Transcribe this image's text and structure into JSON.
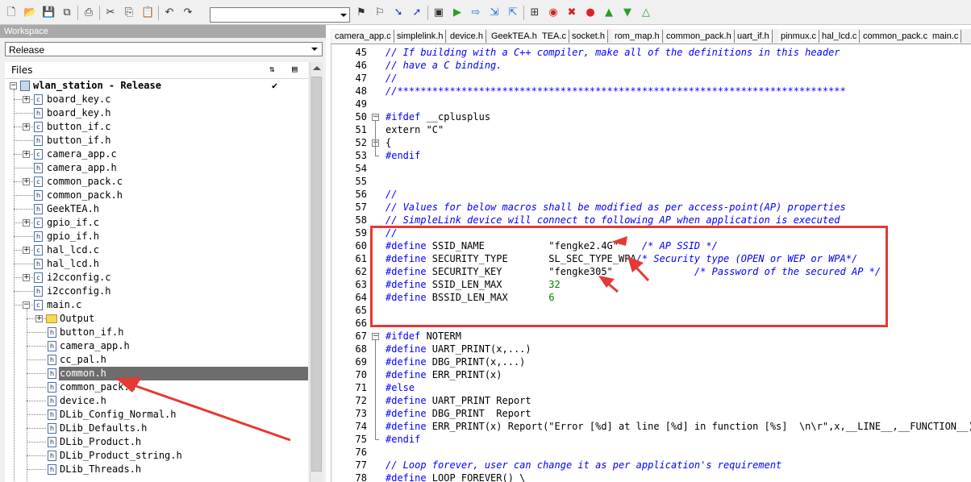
{
  "toolbar": {
    "icons": [
      "new-file-icon",
      "open-folder-icon",
      "save-icon",
      "save-all-icon",
      "print-icon",
      "cut-icon",
      "copy-icon",
      "paste-icon",
      "undo-icon",
      "redo-icon",
      "find-combo",
      "toggle-bookmark-icon",
      "clear-bookmarks-icon",
      "next-bookmark-icon",
      "prev-bookmark-icon",
      "compile-icon",
      "go-icon",
      "step-over-icon",
      "step-into-icon",
      "step-out-icon",
      "disassembly-icon",
      "breakpoint-icon",
      "clear-breakpoints-icon",
      "stop-icon",
      "debug-icon",
      "download-icon",
      "run-icon"
    ],
    "combo_value": ""
  },
  "workspace": {
    "title": "Workspace",
    "configuration": "Release",
    "files_header": "Files",
    "project": "wlan_station - Release",
    "project_check": "✔",
    "items": [
      {
        "name": "board_key.c",
        "type": "c",
        "expandable": true
      },
      {
        "name": "board_key.h",
        "type": "h",
        "expandable": false
      },
      {
        "name": "button_if.c",
        "type": "c",
        "expandable": true
      },
      {
        "name": "button_if.h",
        "type": "h",
        "expandable": false
      },
      {
        "name": "camera_app.c",
        "type": "c",
        "expandable": true
      },
      {
        "name": "camera_app.h",
        "type": "h",
        "expandable": false
      },
      {
        "name": "common_pack.c",
        "type": "c",
        "expandable": true
      },
      {
        "name": "common_pack.h",
        "type": "h",
        "expandable": false
      },
      {
        "name": "GeekTEA.h",
        "type": "h",
        "expandable": false
      },
      {
        "name": "gpio_if.c",
        "type": "c",
        "expandable": true
      },
      {
        "name": "gpio_if.h",
        "type": "h",
        "expandable": false
      },
      {
        "name": "hal_lcd.c",
        "type": "c",
        "expandable": true
      },
      {
        "name": "hal_lcd.h",
        "type": "h",
        "expandable": false
      },
      {
        "name": "i2cconfig.c",
        "type": "c",
        "expandable": true
      },
      {
        "name": "i2cconfig.h",
        "type": "h",
        "expandable": false
      },
      {
        "name": "main.c",
        "type": "c",
        "expandable": true,
        "expanded": true
      }
    ],
    "main_children": [
      {
        "name": "Output",
        "type": "folder"
      },
      {
        "name": "button_if.h",
        "type": "h"
      },
      {
        "name": "camera_app.h",
        "type": "h"
      },
      {
        "name": "cc_pal.h",
        "type": "h"
      },
      {
        "name": "common.h",
        "type": "h",
        "selected": true
      },
      {
        "name": "common_pack.h",
        "type": "h"
      },
      {
        "name": "device.h",
        "type": "h"
      },
      {
        "name": "DLib_Config_Normal.h",
        "type": "h"
      },
      {
        "name": "DLib_Defaults.h",
        "type": "h"
      },
      {
        "name": "DLib_Product.h",
        "type": "h"
      },
      {
        "name": "DLib_Product_string.h",
        "type": "h"
      },
      {
        "name": "DLib_Threads.h",
        "type": "h"
      }
    ]
  },
  "tabs": [
    "camera_app.c",
    "simplelink.h",
    "device.h",
    "GeekTEA.h",
    "TEA.c",
    "socket.h",
    "rom_map.h",
    "common_pack.h",
    "uart_if.h",
    "pinmux.c",
    "hal_lcd.c",
    "common_pack.c",
    "main.c"
  ],
  "editor": {
    "lines": [
      {
        "n": "45",
        "segs": [
          {
            "t": "// If building with a C++ compiler, make all of the definitions in this header",
            "c": "cm"
          }
        ]
      },
      {
        "n": "46",
        "segs": [
          {
            "t": "// have a C binding.",
            "c": "cm"
          }
        ]
      },
      {
        "n": "47",
        "segs": [
          {
            "t": "//",
            "c": "cm"
          }
        ]
      },
      {
        "n": "48",
        "segs": [
          {
            "t": "//*****************************************************************************",
            "c": "cm"
          }
        ]
      },
      {
        "n": "49",
        "segs": []
      },
      {
        "n": "50",
        "segs": [
          {
            "t": "#ifdef",
            "c": "pp"
          },
          {
            "t": " __cplusplus",
            "c": ""
          }
        ],
        "fold": "box"
      },
      {
        "n": "51",
        "segs": [
          {
            "t": "extern \"C\"",
            "c": ""
          }
        ]
      },
      {
        "n": "52",
        "segs": [
          {
            "t": "{",
            "c": ""
          }
        ],
        "fold": "box"
      },
      {
        "n": "53",
        "segs": [
          {
            "t": "#endif",
            "c": "pp"
          }
        ],
        "fold": "end"
      },
      {
        "n": "54",
        "segs": []
      },
      {
        "n": "55",
        "segs": []
      },
      {
        "n": "56",
        "segs": [
          {
            "t": "//",
            "c": "cm"
          }
        ]
      },
      {
        "n": "57",
        "segs": [
          {
            "t": "// Values for below macros shall be modified as per access-point(AP) properties",
            "c": "cm"
          }
        ]
      },
      {
        "n": "58",
        "segs": [
          {
            "t": "// SimpleLink device will connect to following AP when application is executed",
            "c": "cm"
          }
        ]
      },
      {
        "n": "59",
        "segs": [
          {
            "t": "//",
            "c": "cm"
          }
        ]
      },
      {
        "n": "60",
        "segs": [
          {
            "t": "#define",
            "c": "pp"
          },
          {
            "t": " SSID_NAME           \"fengke2.4G\"    ",
            "c": ""
          },
          {
            "t": "/* AP SSID */",
            "c": "cm"
          }
        ]
      },
      {
        "n": "61",
        "segs": [
          {
            "t": "#define",
            "c": "pp"
          },
          {
            "t": " SECURITY_TYPE       SL_SEC_TYPE_WPA",
            "c": ""
          },
          {
            "t": "/* Security type (OPEN or WEP or WPA*/",
            "c": "cm"
          }
        ]
      },
      {
        "n": "62",
        "segs": [
          {
            "t": "#define",
            "c": "pp"
          },
          {
            "t": " SECURITY_KEY        \"fengke305\"              ",
            "c": ""
          },
          {
            "t": "/* Password of the secured AP */",
            "c": "cm"
          }
        ]
      },
      {
        "n": "63",
        "segs": [
          {
            "t": "#define",
            "c": "pp"
          },
          {
            "t": " SSID_LEN_MAX        ",
            "c": ""
          },
          {
            "t": "32",
            "c": "nb"
          }
        ]
      },
      {
        "n": "64",
        "segs": [
          {
            "t": "#define",
            "c": "pp"
          },
          {
            "t": " BSSID_LEN_MAX       ",
            "c": ""
          },
          {
            "t": "6",
            "c": "nb"
          }
        ]
      },
      {
        "n": "65",
        "segs": []
      },
      {
        "n": "66",
        "segs": []
      },
      {
        "n": "67",
        "segs": [
          {
            "t": "#ifdef",
            "c": "pp"
          },
          {
            "t": " NOTERM",
            "c": ""
          }
        ],
        "fold": "box"
      },
      {
        "n": "68",
        "segs": [
          {
            "t": "#define",
            "c": "pp"
          },
          {
            "t": " UART_PRINT(x,...)",
            "c": ""
          }
        ]
      },
      {
        "n": "69",
        "segs": [
          {
            "t": "#define",
            "c": "pp"
          },
          {
            "t": " DBG_PRINT(x,...)",
            "c": ""
          }
        ]
      },
      {
        "n": "70",
        "segs": [
          {
            "t": "#define",
            "c": "pp"
          },
          {
            "t": " ERR_PRINT(x)",
            "c": ""
          }
        ]
      },
      {
        "n": "71",
        "segs": [
          {
            "t": "#else",
            "c": "pp"
          }
        ]
      },
      {
        "n": "72",
        "segs": [
          {
            "t": "#define",
            "c": "pp"
          },
          {
            "t": " UART_PRINT Report",
            "c": ""
          }
        ]
      },
      {
        "n": "73",
        "segs": [
          {
            "t": "#define",
            "c": "pp"
          },
          {
            "t": " DBG_PRINT  Report",
            "c": ""
          }
        ]
      },
      {
        "n": "74",
        "segs": [
          {
            "t": "#define",
            "c": "pp"
          },
          {
            "t": " ERR_PRINT(x) Report(\"Error [%d] at line [%d] in function [%s]  \\n\\r\",x,__LINE__,__FUNCTION__)",
            "c": ""
          }
        ]
      },
      {
        "n": "75",
        "segs": [
          {
            "t": "#endif",
            "c": "pp"
          }
        ],
        "fold": "end"
      },
      {
        "n": "76",
        "segs": []
      },
      {
        "n": "77",
        "segs": [
          {
            "t": "// Loop forever, user can change it as per application's requirement",
            "c": "cm"
          }
        ]
      },
      {
        "n": "78",
        "segs": [
          {
            "t": "#define",
            "c": "pp"
          },
          {
            "t": " LOOP_FOREVER() \\",
            "c": ""
          }
        ]
      }
    ]
  },
  "colors": {
    "comment": "#0000ff",
    "preproc": "#0000ff",
    "number": "#008000",
    "annotation": "#e53935",
    "selection": "#6d6d6d"
  }
}
